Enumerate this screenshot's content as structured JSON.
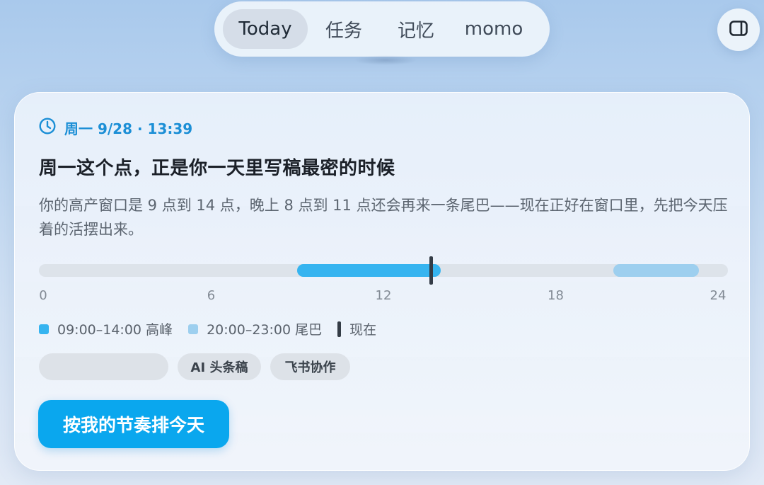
{
  "nav": {
    "tabs": [
      {
        "label": "Today",
        "active": true
      },
      {
        "label": "任务",
        "active": false
      },
      {
        "label": "记忆",
        "active": false
      },
      {
        "label": "momo",
        "active": false
      }
    ],
    "panel_icon": "sidebar-toggle-icon"
  },
  "card": {
    "timestamp": "周一 9/28 · 13:39",
    "timestamp_icon": "clock-icon",
    "headline": "周一这个点，正是你一天里写稿最密的时候",
    "description": "你的高产窗口是 9 点到 14 点，晚上 8 点到 11 点还会再来一条尾巴——现在正好在窗口里，先把今天压着的活摆出来。",
    "timeline": {
      "range": [
        0,
        24
      ],
      "ticks": [
        "0",
        "6",
        "12",
        "18",
        "24"
      ],
      "peak": {
        "start": 9,
        "end": 14,
        "color": "#36b4f0"
      },
      "tail": {
        "start": 20,
        "end": 23,
        "color": "#9dcfef"
      },
      "now": 13.65
    },
    "legend": {
      "peak_label": "09:00–14:00 高峰",
      "tail_label": "20:00–23:00 尾巴",
      "now_label": "现在"
    },
    "chips": [
      "",
      "AI 头条稿",
      "飞书协作"
    ],
    "cta_label": "按我的节奏排今天"
  },
  "colors": {
    "accent": "#0aa7ee",
    "timestamp": "#1c8fd6",
    "peak": "#36b4f0",
    "tail": "#9dcfef",
    "now_marker": "#343c46"
  }
}
